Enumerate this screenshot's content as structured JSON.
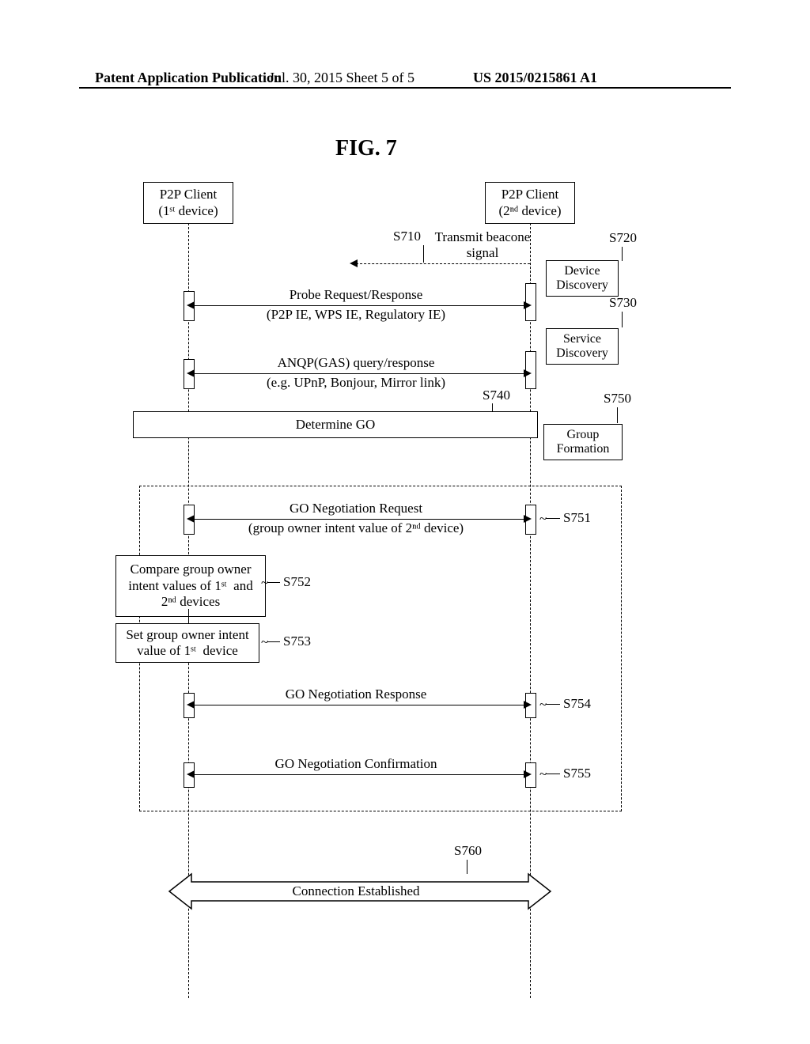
{
  "header": {
    "left": "Patent Application Publication",
    "date": "Jul. 30, 2015  Sheet 5 of 5",
    "pub": "US 2015/0215861 A1"
  },
  "figure_label": "FIG.  7",
  "entities": {
    "left": {
      "line1": "P2P  Client",
      "line2": "(1ˢᵗ device)"
    },
    "right": {
      "line1": "P2P  Client",
      "line2": "(2ⁿᵈ device)"
    }
  },
  "phases": {
    "device_discovery": "Device\nDiscovery",
    "service_discovery": "Service\nDiscovery",
    "group_formation": "Group\nFormation"
  },
  "steps": {
    "s710": {
      "id": "S710",
      "label": "Transmit beacone\nsignal"
    },
    "s720": "S720",
    "s730": "S730",
    "s740": "S740",
    "s750": "S750",
    "s751": "S751",
    "s752": "S752",
    "s753": "S753",
    "s754": "S754",
    "s755": "S755",
    "s760": "S760"
  },
  "messages": {
    "probe": {
      "main": "Probe Request/Response",
      "sub": "(P2P IE, WPS IE, Regulatory IE)"
    },
    "anqp": {
      "main": "ANQP(GAS) query/response",
      "sub": "(e.g. UPnP,  Bonjour, Mirror link)"
    },
    "determine_go": "Determine GO",
    "go_neg_req": {
      "main": "GO Negotiation Request",
      "sub": "(group owner intent value of 2ⁿᵈ device)"
    },
    "go_neg_resp": "GO Negotiation Response",
    "go_neg_conf": "GO Negotiation Confirmation",
    "connection": "Connection Established"
  },
  "boxes": {
    "compare": "Compare group owner\nintent values of 1ˢᵗ  and\n2ⁿᵈ devices",
    "set_intent": "Set group owner intent\nvalue of 1ˢᵗ  device"
  },
  "chart_data": {
    "type": "sequence_diagram",
    "participants": [
      "P2P Client (1st device)",
      "P2P Client (2nd device)"
    ],
    "phases": [
      {
        "name": "Device Discovery",
        "steps": [
          "S710",
          "S720: Probe Request/Response (P2P IE, WPS IE, Regulatory IE)"
        ]
      },
      {
        "name": "Service Discovery",
        "steps": [
          "S730: ANQP(GAS) query/response (e.g. UPnP, Bonjour, Mirror link)"
        ]
      },
      {
        "name": "Group Formation",
        "steps": [
          "S740: Determine GO",
          "S750 detail: S751-S755"
        ]
      }
    ],
    "messages": [
      {
        "id": "S710",
        "from": "2nd device",
        "to": "1st device",
        "label": "Transmit beacone signal",
        "style": "dashed",
        "direction": "left"
      },
      {
        "id": "S720_probe",
        "from": "1st device",
        "to": "2nd device",
        "label": "Probe Request/Response (P2P IE, WPS IE, Regulatory IE)",
        "direction": "both"
      },
      {
        "id": "S730_anqp",
        "from": "1st device",
        "to": "2nd device",
        "label": "ANQP(GAS) query/response (e.g. UPnP, Bonjour, Mirror link)",
        "direction": "both"
      },
      {
        "id": "S740",
        "spanning": true,
        "label": "Determine GO"
      },
      {
        "id": "S751",
        "from": "1st device",
        "to": "2nd device",
        "label": "GO Negotiation Request (group owner intent value of 2nd device)",
        "direction": "both"
      },
      {
        "id": "S752",
        "at": "1st device",
        "label": "Compare group owner intent values of 1st and 2nd devices"
      },
      {
        "id": "S753",
        "at": "1st device",
        "label": "Set group owner intent value of 1st device"
      },
      {
        "id": "S754",
        "from": "1st device",
        "to": "2nd device",
        "label": "GO Negotiation Response",
        "direction": "both"
      },
      {
        "id": "S755",
        "from": "1st device",
        "to": "2nd device",
        "label": "GO Negotiation Confirmation",
        "direction": "both"
      },
      {
        "id": "S760",
        "from": "1st device",
        "to": "2nd device",
        "label": "Connection Established",
        "direction": "both",
        "style": "block-arrow"
      }
    ]
  }
}
